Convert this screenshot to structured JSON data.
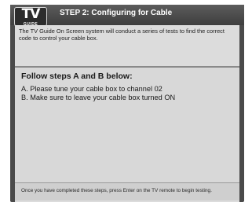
{
  "logo": {
    "top": "TV",
    "bottom": "GUIDE"
  },
  "header": {
    "title": "STEP 2: Configuring for Cable"
  },
  "intro_text": "The TV Guide On Screen system will conduct a series of tests to find the correct code to control your cable box.",
  "instructions": {
    "heading": "Follow steps A and B below:",
    "steps": [
      "A.  Please tune your cable box to channel 02",
      "B.  Make sure to leave your cable box turned ON"
    ]
  },
  "footer_text": "Once you have completed these steps, press Enter on the TV remote to begin testing."
}
